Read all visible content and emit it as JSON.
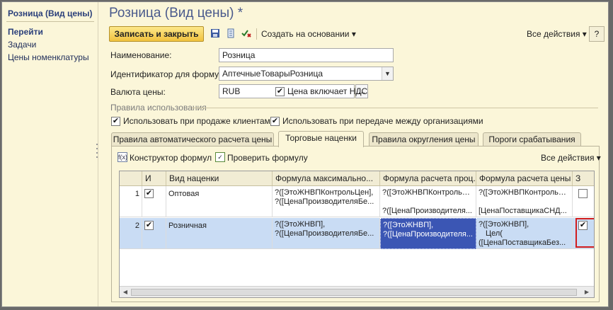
{
  "nav": {
    "title": "Розница (Вид цены)",
    "section": "Перейти",
    "links": [
      "Задачи",
      "Цены номенклатуры"
    ]
  },
  "main": {
    "title": "Розница (Вид цены) *",
    "toolbar": {
      "save_close": "Записать и закрыть",
      "create_based": "Создать на основании ▾",
      "all_actions": "Все действия ▾",
      "help": "?"
    },
    "form": {
      "name_label": "Наименование:",
      "name_value": "Розница",
      "formula_id_label": "Идентификатор для формул:",
      "formula_id_value": "АптечныеТоварыРозница",
      "currency_label": "Валюта цены:",
      "currency_value": "RUB",
      "currency_select": "...",
      "vat_included": "Цена включает НДС"
    },
    "usage": {
      "title": "Правила использования",
      "use_sale": "Использовать при продаже клиентам",
      "use_transfer": "Использовать при передаче между организациями"
    },
    "tabs": [
      "Правила автоматического расчета цены",
      "Торговые наценки",
      "Правила округления цены",
      "Пороги срабатывания"
    ],
    "tab_toolbar": {
      "constructor": "Конструктор формул",
      "check": "Проверить формулу",
      "all_actions": "Все действия ▾"
    },
    "table": {
      "headers": [
        "",
        "И",
        "Вид наценки",
        "Формула максимально...",
        "Формула расчета проц...",
        "Формула расчета цены",
        "З"
      ],
      "rows": [
        {
          "n": "1",
          "kind": "Оптовая",
          "max1": "?([ЭтоЖНВПКонтрольЦен],",
          "max2": "?([ЦенаПроизводителяБе...",
          "proc1": "?([ЭтоЖНВПКонтрольЦ...",
          "proc2": "",
          "proc3": "?([ЦенаПроизводителя...",
          "price1": "?([ЭтоЖНВПКонтрольЦ...",
          "price2": "",
          "price3": "[ЦенаПоставщикаСНД..."
        },
        {
          "n": "2",
          "kind": "Розничная",
          "max1": "?([ЭтоЖНВП],",
          "max2": "?([ЦенаПроизводителяБе...",
          "proc1": "?([ЭтоЖНВП],",
          "proc2": "?([ЦенаПроизводителя...",
          "proc3": "",
          "price1": "?([ЭтоЖНВП],",
          "price2": "Цел(",
          "price3": "([ЦенаПоставщикаБез..."
        }
      ]
    }
  }
}
